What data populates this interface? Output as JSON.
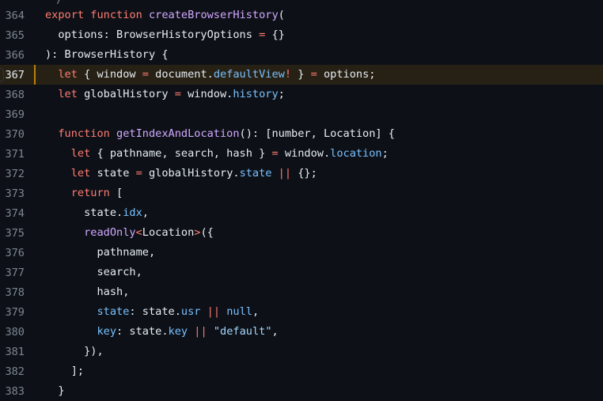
{
  "top_fragment": "*/",
  "lines": [
    {
      "n": "364",
      "segs": [
        [
          "k",
          "export"
        ],
        [
          "p",
          " "
        ],
        [
          "k",
          "function"
        ],
        [
          "p",
          " "
        ],
        [
          "f",
          "createBrowserHistory"
        ],
        [
          "p",
          "("
        ]
      ]
    },
    {
      "n": "365",
      "segs": [
        [
          "p",
          "  options: BrowserHistoryOptions "
        ],
        [
          "k",
          "="
        ],
        [
          "p",
          " {}"
        ]
      ]
    },
    {
      "n": "366",
      "segs": [
        [
          "p",
          "): BrowserHistory {"
        ]
      ]
    },
    {
      "n": "367",
      "segs": [
        [
          "p",
          "  "
        ],
        [
          "k",
          "let"
        ],
        [
          "p",
          " { window "
        ],
        [
          "k",
          "="
        ],
        [
          "p",
          " document."
        ],
        [
          "c",
          "defaultView"
        ],
        [
          "k",
          "!"
        ],
        [
          "p",
          " } "
        ],
        [
          "k",
          "="
        ],
        [
          "p",
          " options;"
        ]
      ]
    },
    {
      "n": "368",
      "segs": [
        [
          "p",
          "  "
        ],
        [
          "k",
          "let"
        ],
        [
          "p",
          " globalHistory "
        ],
        [
          "k",
          "="
        ],
        [
          "p",
          " window."
        ],
        [
          "c",
          "history"
        ],
        [
          "p",
          ";"
        ]
      ]
    },
    {
      "n": "369",
      "segs": []
    },
    {
      "n": "370",
      "segs": [
        [
          "p",
          "  "
        ],
        [
          "k",
          "function"
        ],
        [
          "p",
          " "
        ],
        [
          "f",
          "getIndexAndLocation"
        ],
        [
          "p",
          "(): [number, Location] {"
        ]
      ]
    },
    {
      "n": "371",
      "segs": [
        [
          "p",
          "    "
        ],
        [
          "k",
          "let"
        ],
        [
          "p",
          " { pathname, search, hash } "
        ],
        [
          "k",
          "="
        ],
        [
          "p",
          " window."
        ],
        [
          "c",
          "location"
        ],
        [
          "p",
          ";"
        ]
      ]
    },
    {
      "n": "372",
      "segs": [
        [
          "p",
          "    "
        ],
        [
          "k",
          "let"
        ],
        [
          "p",
          " state "
        ],
        [
          "k",
          "="
        ],
        [
          "p",
          " globalHistory."
        ],
        [
          "c",
          "state"
        ],
        [
          "p",
          " "
        ],
        [
          "k",
          "||"
        ],
        [
          "p",
          " {};"
        ]
      ]
    },
    {
      "n": "373",
      "segs": [
        [
          "p",
          "    "
        ],
        [
          "k",
          "return"
        ],
        [
          "p",
          " ["
        ]
      ]
    },
    {
      "n": "374",
      "segs": [
        [
          "p",
          "      state."
        ],
        [
          "c",
          "idx"
        ],
        [
          "p",
          ","
        ]
      ]
    },
    {
      "n": "375",
      "segs": [
        [
          "p",
          "      "
        ],
        [
          "f",
          "readOnly"
        ],
        [
          "k",
          "<"
        ],
        [
          "p",
          "Location"
        ],
        [
          "k",
          ">"
        ],
        [
          "p",
          "({"
        ]
      ]
    },
    {
      "n": "376",
      "segs": [
        [
          "p",
          "        pathname,"
        ]
      ]
    },
    {
      "n": "377",
      "segs": [
        [
          "p",
          "        search,"
        ]
      ]
    },
    {
      "n": "378",
      "segs": [
        [
          "p",
          "        hash,"
        ]
      ]
    },
    {
      "n": "379",
      "segs": [
        [
          "p",
          "        "
        ],
        [
          "c",
          "state"
        ],
        [
          "p",
          ": state."
        ],
        [
          "c",
          "usr"
        ],
        [
          "p",
          " "
        ],
        [
          "k",
          "||"
        ],
        [
          "p",
          " "
        ],
        [
          "c",
          "null"
        ],
        [
          "p",
          ","
        ]
      ]
    },
    {
      "n": "380",
      "segs": [
        [
          "p",
          "        "
        ],
        [
          "c",
          "key"
        ],
        [
          "p",
          ": state."
        ],
        [
          "c",
          "key"
        ],
        [
          "p",
          " "
        ],
        [
          "k",
          "||"
        ],
        [
          "p",
          " "
        ],
        [
          "s",
          "\"default\""
        ],
        [
          "p",
          ","
        ]
      ]
    },
    {
      "n": "381",
      "segs": [
        [
          "p",
          "      }),"
        ]
      ]
    },
    {
      "n": "382",
      "segs": [
        [
          "p",
          "    ];"
        ]
      ]
    },
    {
      "n": "383",
      "segs": [
        [
          "p",
          "  }"
        ]
      ]
    }
  ],
  "highlighted_line": "367",
  "colors": {
    "background": "#0d1117",
    "keyword": "#ff7b72",
    "function": "#d2a8ff",
    "constant": "#79c0ff",
    "string": "#a5d6ff",
    "text": "#e6edf3",
    "line_number": "#7d8590",
    "highlight_bg": "#272115",
    "highlight_bar": "#bb8009"
  }
}
